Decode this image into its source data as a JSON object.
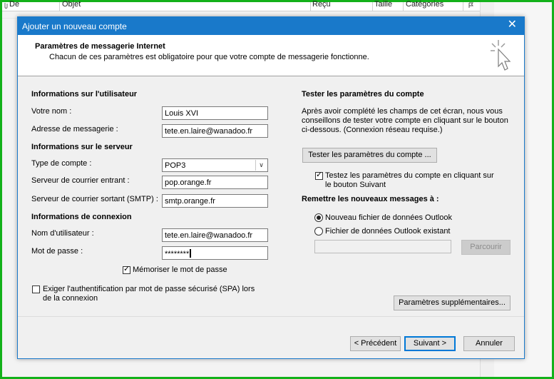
{
  "background": {
    "columns": [
      "De",
      "Objet",
      "Reçu",
      "Taille",
      "Catégories"
    ]
  },
  "dialog": {
    "title": "Ajouter un nouveau compte",
    "close_glyph": "✕",
    "header_title": "Paramètres de messagerie Internet",
    "header_subtitle": "Chacun de ces paramètres est obligatoire pour que votre compte de messagerie fonctionne."
  },
  "user_info": {
    "section": "Informations sur l'utilisateur",
    "name_label": "Votre nom :",
    "name_value": "Louis XVI",
    "email_label": "Adresse de messagerie :",
    "email_value": "tete.en.laire@wanadoo.fr"
  },
  "server_info": {
    "section": "Informations sur le serveur",
    "account_type_label": "Type de compte :",
    "account_type_value": "POP3",
    "incoming_label": "Serveur de courrier entrant :",
    "incoming_value": "pop.orange.fr",
    "outgoing_label": "Serveur de courrier sortant (SMTP) :",
    "outgoing_value": "smtp.orange.fr"
  },
  "login_info": {
    "section": "Informations de connexion",
    "user_label": "Nom d'utilisateur :",
    "user_value": "tete.en.laire@wanadoo.fr",
    "password_label": "Mot de passe :",
    "password_value": "********",
    "remember_label": "Mémoriser le mot de passe",
    "remember_checked": true,
    "spa_label_line1": "Exiger l'authentification par mot de passe sécurisé (SPA) lors",
    "spa_label_line2": "de la connexion",
    "spa_checked": false
  },
  "test_settings": {
    "section": "Tester les paramètres du compte",
    "desc_line1": "Après avoir complété les champs de cet écran, nous vous",
    "desc_line2": "conseillons de tester votre compte en cliquant sur le bouton",
    "desc_line3": "ci-dessous. (Connexion réseau requise.)",
    "test_button": "Tester les paramètres du compte ...",
    "auto_test_line1": "Testez les paramètres du compte en cliquant sur",
    "auto_test_line2": "le bouton Suivant",
    "auto_test_checked": true
  },
  "deliver": {
    "section": "Remettre les nouveaux messages à :",
    "new_file_label": "Nouveau fichier de données Outlook",
    "existing_file_label": "Fichier de données Outlook existant",
    "selected": "new",
    "path_value": "",
    "browse_button": "Parcourir"
  },
  "more_settings_button": "Paramètres supplémentaires...",
  "footer": {
    "back_button": "< Précédent",
    "next_button": "Suivant >",
    "cancel_button": "Annuler"
  },
  "colors": {
    "frame": "#13b11a",
    "titlebar": "#1979ca",
    "dialog_bg": "#f0f0f0"
  }
}
